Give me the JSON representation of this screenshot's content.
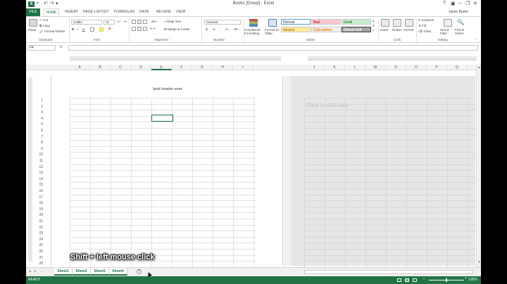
{
  "window": {
    "title": "Book1 [Group] - Excel",
    "user": "Jason Burke"
  },
  "tabs": [
    "FILE",
    "HOME",
    "INSERT",
    "PAGE LAYOUT",
    "FORMULAS",
    "DATA",
    "REVIEW",
    "VIEW"
  ],
  "ribbon": {
    "clipboard": {
      "paste": "Paste",
      "cut": "Cut",
      "copy": "Copy",
      "format_painter": "Format Painter",
      "label": "Clipboard"
    },
    "font": {
      "name": "Calibri",
      "size": "11",
      "bold": "B",
      "italic": "I",
      "underline": "U",
      "label": "Font"
    },
    "alignment": {
      "wrap": "Wrap Text",
      "merge": "Merge & Center",
      "label": "Alignment"
    },
    "number": {
      "format": "General",
      "currency": "$",
      "percent": "%",
      "comma": ",",
      "label": "Number"
    },
    "styles": {
      "conditional": "Conditional Formatting",
      "format_as_table": "Format as Table",
      "normal": "Normal",
      "bad": "Bad",
      "good": "Good",
      "neutral": "Neutral",
      "calculation": "Calculation",
      "check_cell": "Check Cell",
      "label": "Styles",
      "colors": {
        "bad_bg": "#ffc7ce",
        "bad_fg": "#9c0006",
        "good_bg": "#c6efce",
        "good_fg": "#006100",
        "neutral_bg": "#ffeb9c",
        "neutral_fg": "#9c5700",
        "calc_bg": "#f2f2f2",
        "calc_fg": "#fa7d00",
        "check_bg": "#a5a5a5",
        "check_fg": "#ffffff"
      }
    },
    "cells": {
      "insert": "Insert",
      "delete": "Delete",
      "format": "Format",
      "label": "Cells"
    },
    "editing": {
      "autosum": "AutoSum",
      "fill": "Fill",
      "clear": "Clear",
      "sort": "Sort & Filter",
      "find": "Find & Select",
      "label": "Editing"
    }
  },
  "formula_bar": {
    "name_box": "F4",
    "fx": "fx",
    "value": ""
  },
  "columns_left": [
    "A",
    "B",
    "C",
    "D",
    "E",
    "F",
    "G",
    "H",
    "I"
  ],
  "columns_right": [
    "J",
    "K",
    "L",
    "M",
    "N",
    "O",
    "P",
    "Q"
  ],
  "active_column": "E",
  "active_row": "4",
  "rows": [
    "1",
    "2",
    "3",
    "4",
    "5",
    "6",
    "7",
    "8",
    "9",
    "10",
    "11",
    "12",
    "13",
    "14",
    "15",
    "16",
    "17",
    "18",
    "19",
    "20",
    "21",
    "22",
    "23",
    "24",
    "25",
    "26",
    "27",
    "28"
  ],
  "page1": {
    "header": "best header ever"
  },
  "page2": {
    "placeholder": "Click to add data"
  },
  "sheets": [
    "Sheet1",
    "Sheet2",
    "Sheet3",
    "Sheet4"
  ],
  "status": {
    "ready": "READY",
    "zoom": "100%"
  },
  "caption": "Shift + left mouse click",
  "accent_color": "#217346"
}
